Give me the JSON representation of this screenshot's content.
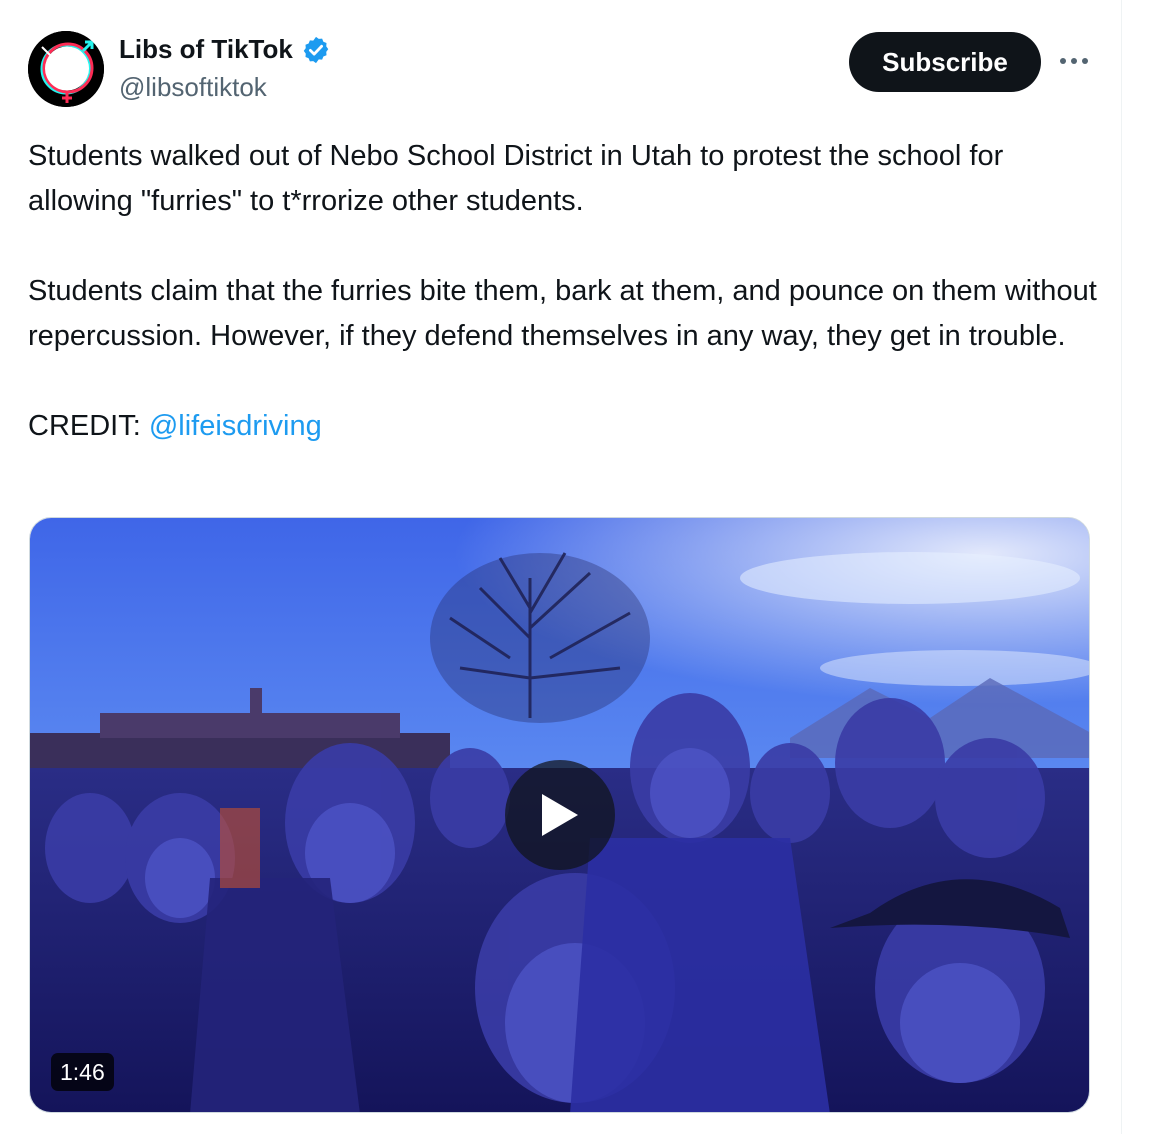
{
  "author": {
    "display_name": "Libs of TikTok",
    "handle": "@libsoftiktok",
    "avatar_text": "Libs of TikTok",
    "verified": true
  },
  "actions": {
    "subscribe_label": "Subscribe",
    "more_icon": "more-horizontal-icon"
  },
  "tweet": {
    "paragraph_1": "Students walked out of Nebo School District in Utah to protest the school for allowing \"furries\" to t*rrorize other students.",
    "paragraph_2": "Students claim that the furries bite them, bark at them, and pounce on them without repercussion. However, if they defend themselves in any way, they get in trouble.",
    "credit_label": "CREDIT: ",
    "credit_mention": "@lifeisdriving"
  },
  "media": {
    "type": "video",
    "duration": "1:46",
    "play_icon": "play-icon"
  },
  "colors": {
    "text": "#0f1419",
    "secondary": "#536471",
    "link": "#1d9bf0",
    "verified": "#1d9bf0",
    "button_bg": "#0f1419"
  }
}
